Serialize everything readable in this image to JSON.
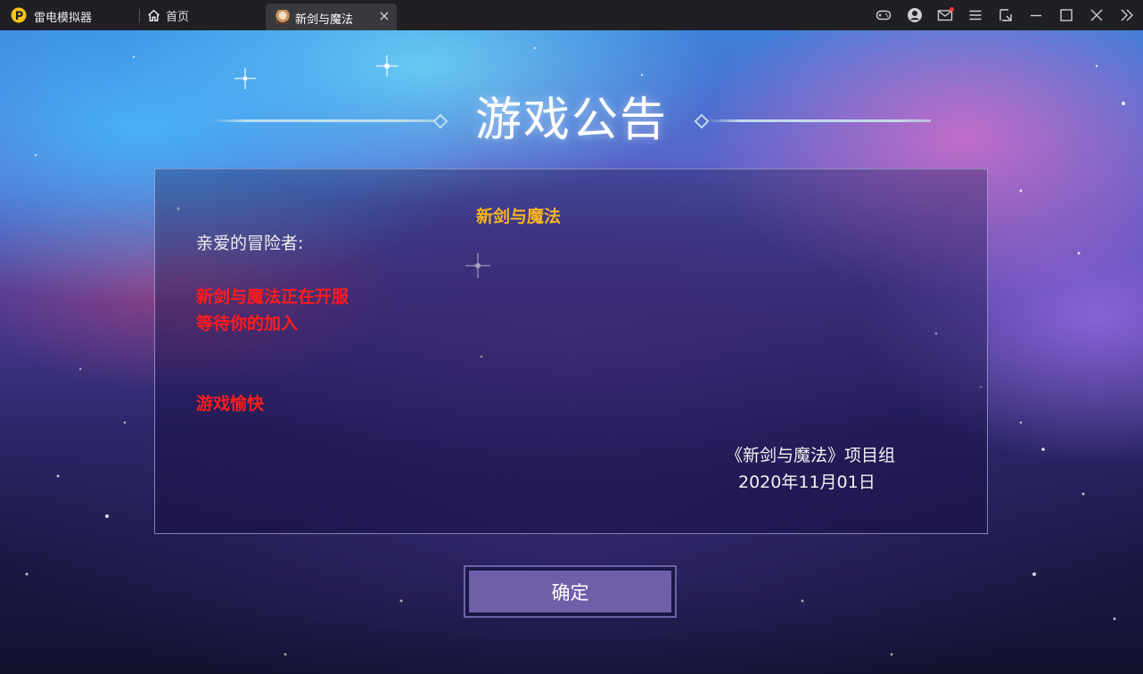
{
  "app": {
    "name": "雷电模拟器"
  },
  "tabs": {
    "home_label": "首页",
    "active_label": "新剑与魔法"
  },
  "toolbar": {
    "icons": [
      "gamepad-icon",
      "user-icon",
      "mail-icon",
      "menu-icon",
      "resize-icon",
      "minimize-icon",
      "maximize-icon",
      "close-icon",
      "collapse-sidebar-icon"
    ],
    "notification_dot_color": "#ff3b30"
  },
  "notice": {
    "title": "游戏公告",
    "heading": "新剑与魔法",
    "greeting": "亲爱的冒险者:",
    "lines": [
      "新剑与魔法正在开服",
      "等待你的加入",
      "游戏愉快"
    ],
    "signature": "《新剑与魔法》项目组",
    "date": "2020年11月01日"
  },
  "confirm_button": {
    "label": "确定"
  },
  "colors": {
    "heading": "#f5b523",
    "highlight_text": "#ff1c1c",
    "button_face": "#6f5fa8",
    "titlebar": "#1f1f24"
  }
}
